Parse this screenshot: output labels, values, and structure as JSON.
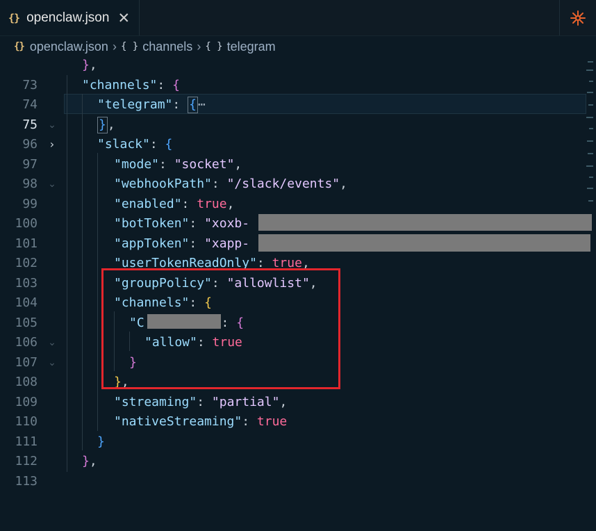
{
  "tab": {
    "icon": "{}",
    "label": "openclaw.json",
    "close": "✕",
    "right_icon": "sparkle-icon"
  },
  "breadcrumb": {
    "file": "openclaw.json",
    "items": [
      "channels",
      "telegram"
    ],
    "obj_icon": "{ }",
    "sep": "›"
  },
  "lines": [
    {
      "n": "73",
      "fold": ""
    },
    {
      "n": "74",
      "fold": "open"
    },
    {
      "n": "75",
      "fold": "collapsed"
    },
    {
      "n": "96",
      "fold": ""
    },
    {
      "n": "97",
      "fold": "open"
    },
    {
      "n": "98",
      "fold": ""
    },
    {
      "n": "99",
      "fold": ""
    },
    {
      "n": "100",
      "fold": ""
    },
    {
      "n": "101",
      "fold": ""
    },
    {
      "n": "102",
      "fold": ""
    },
    {
      "n": "103",
      "fold": ""
    },
    {
      "n": "104",
      "fold": ""
    },
    {
      "n": "105",
      "fold": "open"
    },
    {
      "n": "106",
      "fold": "open"
    },
    {
      "n": "107",
      "fold": ""
    },
    {
      "n": "108",
      "fold": ""
    },
    {
      "n": "109",
      "fold": ""
    },
    {
      "n": "110",
      "fold": ""
    },
    {
      "n": "111",
      "fold": ""
    },
    {
      "n": "112",
      "fold": ""
    },
    {
      "n": "113",
      "fold": ""
    }
  ],
  "code": {
    "k_channels": "\"channels\"",
    "k_telegram": "\"telegram\"",
    "k_slack": "\"slack\"",
    "k_mode": "\"mode\"",
    "v_mode": "\"socket\"",
    "k_webhook": "\"webhookPath\"",
    "v_webhook": "\"/slack/events\"",
    "k_enabled": "\"enabled\"",
    "k_bot": "\"botToken\"",
    "v_bot": "\"xoxb-",
    "k_app": "\"appToken\"",
    "v_app": "\"xapp-",
    "k_userToken": "\"userTokenReadOnly\"",
    "k_group": "\"groupPolicy\"",
    "v_group": "\"allowlist\"",
    "k_channels2": "\"channels\"",
    "k_channel_id_start": "\"C",
    "k_channel_id_end": "\"",
    "k_allow": "\"allow\"",
    "k_streaming": "\"streaming\"",
    "v_streaming": "\"partial\"",
    "k_native": "\"nativeStreaming\"",
    "true": "true",
    "ellipsis": "⋯"
  }
}
